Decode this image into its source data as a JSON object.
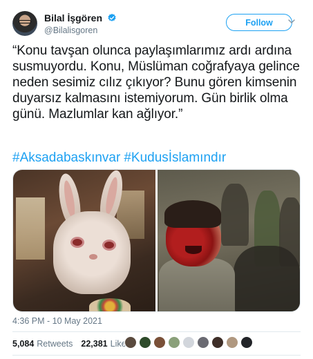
{
  "user": {
    "name": "Bilal İşgören",
    "handle": "@Bilalisgoren",
    "verified": true
  },
  "follow_button": {
    "label": "Follow"
  },
  "tweet": {
    "text": "“Konu tavşan olunca paylaşımlarımız ardı ardına susmuyordu. Konu, Müslüman coğrafyaya gelince neden sesimiz cılız çıkıyor? Bunu gören kimsenin duyarsız kalmasını istemiyorum. Gün birlik olma günü. Mazlumlar kan ağlıyor.”",
    "hashtags": [
      "#Aksadabaskınvar",
      "#Kudusİslamındır"
    ],
    "timestamp": "4:36 PM - 10 May 2021"
  },
  "stats": {
    "retweets_count": "5,084",
    "retweets_label": "Retweets",
    "likes_count": "22,381",
    "likes_label": "Likes"
  },
  "media": [
    {
      "name": "bunny-photo"
    },
    {
      "name": "child-photo"
    }
  ],
  "likers": [
    {
      "color": "#5a4a3e"
    },
    {
      "color": "#2d4a2a"
    },
    {
      "color": "#7a5038"
    },
    {
      "color": "#8aa07a"
    },
    {
      "color": "#d2d6dc"
    },
    {
      "color": "#6a6a72"
    },
    {
      "color": "#3e2e28"
    },
    {
      "color": "#b09880"
    },
    {
      "color": "#222428"
    }
  ],
  "colors": {
    "accent": "#1da1f2",
    "verified": "#1da1f2",
    "text": "#14171a",
    "muted": "#657786"
  }
}
